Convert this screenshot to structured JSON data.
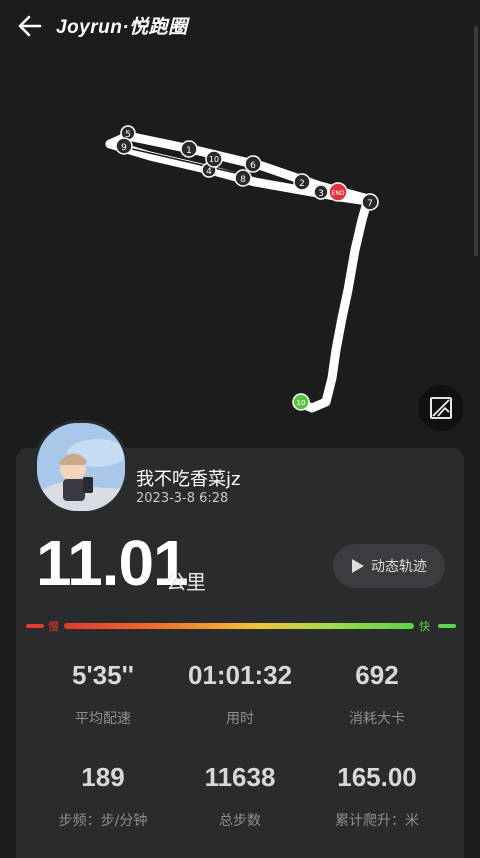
{
  "header": {
    "title": "Joyrun·悦跑圈"
  },
  "map": {
    "km_markers": [
      "1",
      "2",
      "3",
      "4",
      "5",
      "6",
      "7",
      "8",
      "9",
      "10"
    ],
    "end_label": "END",
    "start_label": "10"
  },
  "user": {
    "name": "我不吃香菜jz",
    "date": "2023-3-8 6:28"
  },
  "summary": {
    "distance": "11.01",
    "unit": "公里",
    "play_label": "动态轨迹"
  },
  "pace_bar": {
    "slow_label": "慢",
    "fast_label": "快"
  },
  "stats": [
    {
      "value": "5'35''",
      "label": "平均配速"
    },
    {
      "value": "01:01:32",
      "label": "用时"
    },
    {
      "value": "692",
      "label": "消耗大卡"
    },
    {
      "value": "189",
      "label": "步频：步/分钟"
    },
    {
      "value": "11638",
      "label": "总步数"
    },
    {
      "value": "165.00",
      "label": "累计爬升：米"
    }
  ],
  "colors": {
    "background": "#1b1c1e",
    "card": "#2a2b2d",
    "route": "#ffffff",
    "end_marker": "#e0343b",
    "start_marker": "#5bc43f"
  }
}
